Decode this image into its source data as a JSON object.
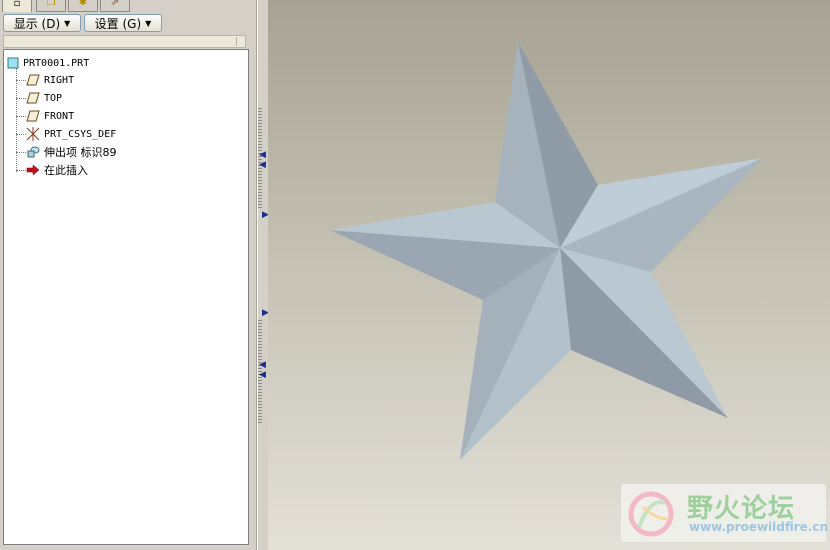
{
  "navigator": {
    "tabs": [
      {
        "icon": "model-tree-tab-icon",
        "glyph": "▫"
      },
      {
        "icon": "folder-browser-tab-icon",
        "glyph": "❐"
      },
      {
        "icon": "favorites-tab-icon",
        "glyph": "✱"
      },
      {
        "icon": "connections-tab-icon",
        "glyph": "⇗"
      }
    ],
    "show_button": "显示 (D)",
    "settings_button": "设置 (G)"
  },
  "model_tree": {
    "root": "PRT0001.PRT",
    "items": [
      {
        "label": "RIGHT",
        "icon": "datum-plane-icon"
      },
      {
        "label": "TOP",
        "icon": "datum-plane-icon"
      },
      {
        "label": "FRONT",
        "icon": "datum-plane-icon"
      },
      {
        "label": "PRT_CSYS_DEF",
        "icon": "coordinate-system-icon"
      },
      {
        "label": "伸出项 标识89",
        "icon": "protrusion-feature-icon"
      },
      {
        "label": "在此插入",
        "icon": "insert-here-arrow-icon"
      }
    ]
  },
  "watermark": {
    "title": "野火论坛",
    "url": "www.proewildfire.cn"
  },
  "colors": {
    "star_light": "#bac8d2",
    "star_mid": "#a8b5bf",
    "star_dark": "#8e9aa5",
    "canvas_top": "#a7a293",
    "canvas_bottom": "#e3e0d8"
  }
}
